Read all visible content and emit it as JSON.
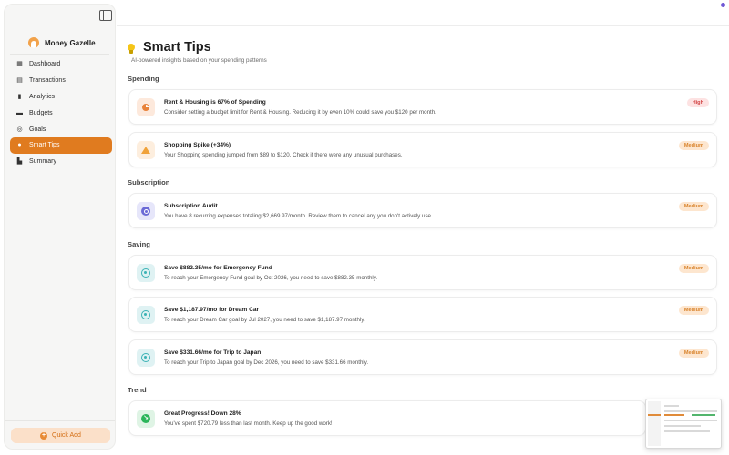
{
  "app": {
    "name": "Money Gazelle"
  },
  "sidebar": {
    "items": [
      {
        "label": "Dashboard",
        "icon": "grid-icon"
      },
      {
        "label": "Transactions",
        "icon": "receipt-icon"
      },
      {
        "label": "Analytics",
        "icon": "bar-chart-icon"
      },
      {
        "label": "Budgets",
        "icon": "wallet-icon"
      },
      {
        "label": "Goals",
        "icon": "target-icon"
      },
      {
        "label": "Smart Tips",
        "icon": "lightbulb-icon",
        "active": true
      },
      {
        "label": "Summary",
        "icon": "document-icon"
      }
    ],
    "quick_add_label": "Quick Add"
  },
  "page": {
    "title": "Smart Tips",
    "subtitle": "AI-powered insights based on your spending patterns"
  },
  "sections": [
    {
      "title": "Spending"
    },
    {
      "title": "Subscription"
    },
    {
      "title": "Saving"
    },
    {
      "title": "Trend"
    }
  ],
  "tips": [
    {
      "title": "Rent & Housing is 67% of Spending",
      "desc": "Consider setting a budget limit for Rent & Housing. Reducing it by even 10% could save you $120 per month.",
      "badge": "High",
      "icon": "pie-chart-icon"
    },
    {
      "title": "Shopping Spike (+34%)",
      "desc": "Your Shopping spending jumped from $89 to $120. Check if there were any unusual purchases.",
      "badge": "Medium",
      "icon": "warning-icon"
    },
    {
      "title": "Subscription Audit",
      "desc": "You have 8 recurring expenses totaling $2,669.97/month. Review them to cancel any you don't actively use.",
      "badge": "Medium",
      "icon": "subscription-icon"
    },
    {
      "title": "Save $882.35/mo for Emergency Fund",
      "desc": "To reach your Emergency Fund goal by Oct 2026, you need to save $882.35 monthly.",
      "badge": "Medium",
      "icon": "target-icon"
    },
    {
      "title": "Save $1,187.97/mo for Dream Car",
      "desc": "To reach your Dream Car goal by Jul 2027, you need to save $1,187.97 monthly.",
      "badge": "Medium",
      "icon": "target-icon"
    },
    {
      "title": "Save $331.66/mo for Trip to Japan",
      "desc": "To reach your Trip to Japan goal by Dec 2026, you need to save $331.66 monthly.",
      "badge": "Medium",
      "icon": "target-icon"
    },
    {
      "title": "Great Progress! Down 28%",
      "desc": "You've spent $720.79 less than last month. Keep up the good work!",
      "icon": "trend-down-icon"
    }
  ],
  "colors": {
    "accent": "#e07b1f",
    "high_badge": "#d24545",
    "medium_badge": "#d8822a"
  }
}
